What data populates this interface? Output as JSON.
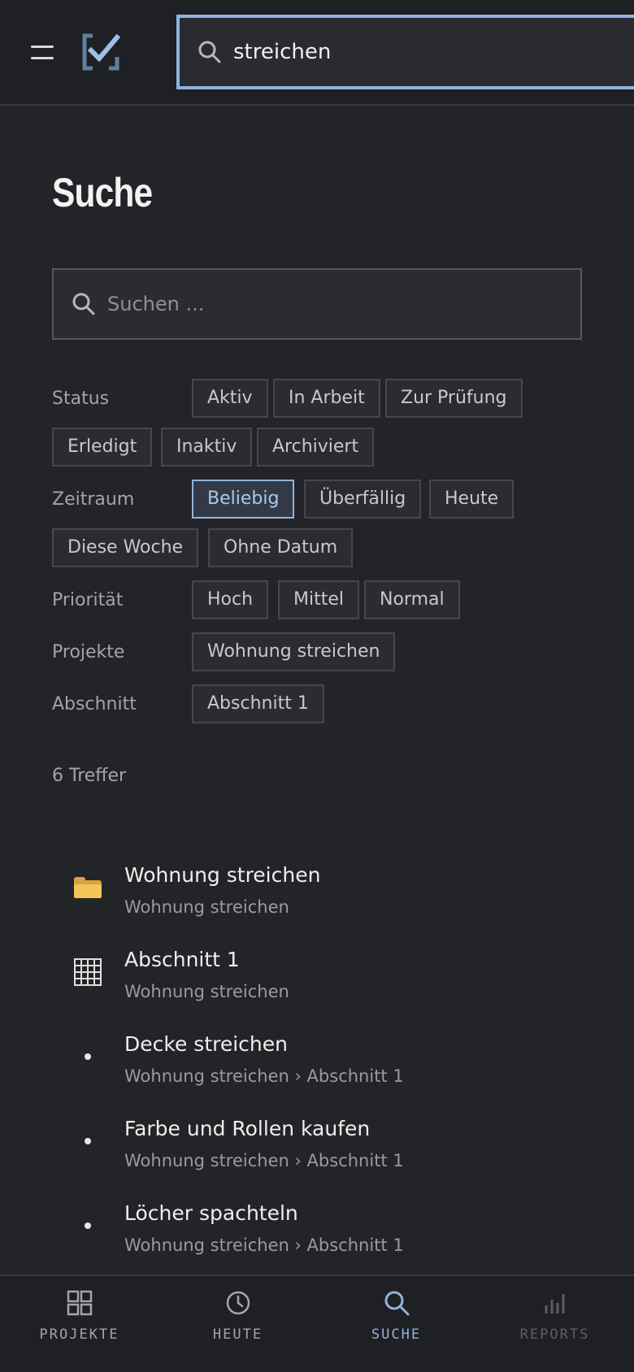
{
  "top_search": {
    "value": "streichen"
  },
  "page": {
    "title": "Suche",
    "search_placeholder": "Suchen ..."
  },
  "filters": {
    "status": {
      "label": "Status",
      "options": [
        "Aktiv",
        "In Arbeit",
        "Zur Prüfung",
        "Erledigt",
        "Inaktiv",
        "Archiviert"
      ]
    },
    "zeitraum": {
      "label": "Zeitraum",
      "options": [
        "Beliebig",
        "Überfällig",
        "Heute",
        "Diese Woche",
        "Ohne Datum"
      ],
      "selected": "Beliebig"
    },
    "prioritaet": {
      "label": "Priorität",
      "options": [
        "Hoch",
        "Mittel",
        "Normal"
      ]
    },
    "projekte": {
      "label": "Projekte",
      "options": [
        "Wohnung streichen"
      ]
    },
    "abschnitt": {
      "label": "Abschnitt",
      "options": [
        "Abschnitt 1"
      ]
    }
  },
  "hits_text": "6 Treffer",
  "results": [
    {
      "icon": "folder-icon",
      "title": "Wohnung streichen",
      "subtitle": "Wohnung streichen"
    },
    {
      "icon": "grid-icon",
      "title": "Abschnitt 1",
      "subtitle": "Wohnung streichen"
    },
    {
      "icon": "bullet-icon",
      "title": "Decke streichen",
      "subtitle": "Wohnung streichen › Abschnitt 1"
    },
    {
      "icon": "bullet-icon",
      "title": "Farbe und Rollen kaufen",
      "subtitle": "Wohnung streichen › Abschnitt 1"
    },
    {
      "icon": "bullet-icon",
      "title": "Löcher spachteln",
      "subtitle": "Wohnung streichen › Abschnitt 1"
    }
  ],
  "bottom_nav": [
    {
      "label": "PROJEKTE",
      "icon": "grid-icon"
    },
    {
      "label": "HEUTE",
      "icon": "clock-icon"
    },
    {
      "label": "SUCHE",
      "icon": "search-icon",
      "active": true
    },
    {
      "label": "REPORTS",
      "icon": "bar-chart-icon",
      "disabled": true
    }
  ],
  "colors": {
    "accent": "#8fb3df",
    "background": "#232427",
    "bar": "#1f2023"
  }
}
